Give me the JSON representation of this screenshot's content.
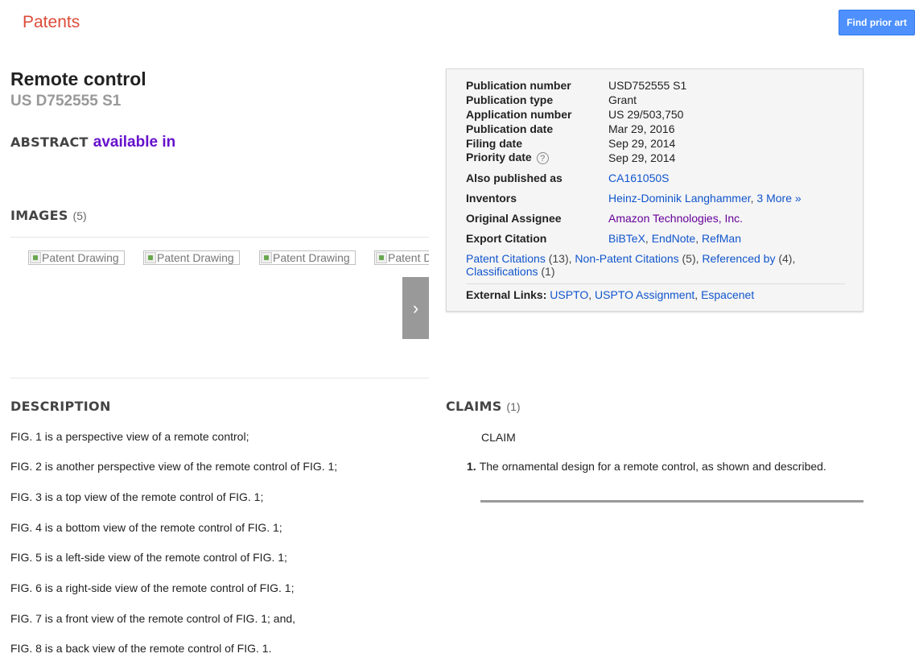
{
  "header": {
    "logo": "Patents",
    "find_prior_art": "Find prior art"
  },
  "patent": {
    "title": "Remote control",
    "number": "US D752555 S1"
  },
  "abstract": {
    "heading": "ABSTRACT",
    "available_in": "available in"
  },
  "images": {
    "heading": "IMAGES",
    "count": "(5)",
    "thumbnail_alt": [
      "Patent Drawing",
      "Patent Drawing",
      "Patent Drawing",
      "Patent Drawing"
    ],
    "next_label": "›"
  },
  "metadata": {
    "publication_number_label": "Publication number",
    "publication_number": "USD752555 S1",
    "publication_type_label": "Publication type",
    "publication_type": "Grant",
    "application_number_label": "Application number",
    "application_number": "US 29/503,750",
    "publication_date_label": "Publication date",
    "publication_date": "Mar 29, 2016",
    "filing_date_label": "Filing date",
    "filing_date": "Sep 29, 2014",
    "priority_date_label": "Priority date",
    "priority_date": "Sep 29, 2014",
    "help_glyph": "?",
    "also_published_label": "Also published as",
    "also_published": "CA161050S",
    "inventors_label": "Inventors",
    "inventor": "Heinz-Dominik Langhammer",
    "inventors_more": "3 More »",
    "assignee_label": "Original Assignee",
    "assignee": "Amazon Technologies, Inc.",
    "export_label": "Export Citation",
    "export_bibtex": "BiBTeX",
    "export_endnote": "EndNote",
    "export_refman": "RefMan",
    "patent_citations": "Patent Citations",
    "patent_citations_count": "(13)",
    "non_patent_citations": "Non-Patent Citations",
    "non_patent_citations_count": "(5)",
    "referenced_by": "Referenced by",
    "referenced_by_count": "(4)",
    "classifications": "Classifications",
    "classifications_count": "(1)",
    "external_links_label": "External Links:",
    "link_uspto": "USPTO",
    "link_uspto_assignment": "USPTO Assignment",
    "link_espacenet": "Espacenet"
  },
  "description": {
    "heading": "DESCRIPTION",
    "lines": [
      "FIG. 1 is a perspective view of a remote control;",
      "FIG. 2 is another perspective view of the remote control of FIG. 1;",
      "FIG. 3 is a top view of the remote control of FIG. 1;",
      "FIG. 4 is a bottom view of the remote control of FIG. 1;",
      "FIG. 5 is a left-side view of the remote control of FIG. 1;",
      "FIG. 6 is a right-side view of the remote control of FIG. 1;",
      "FIG. 7 is a front view of the remote control of FIG. 1; and,",
      "FIG. 8 is a back view of the remote control of FIG. 1."
    ]
  },
  "claims": {
    "heading": "CLAIMS",
    "count": "(1)",
    "claim_heading": "CLAIM",
    "claim_number": "1.",
    "claim_text": "The ornamental design for a remote control, as shown and described."
  },
  "colors": {
    "logo": "#dd4b39",
    "button": "#4d90fe",
    "link": "#1155cc",
    "visited_link": "#660099"
  }
}
